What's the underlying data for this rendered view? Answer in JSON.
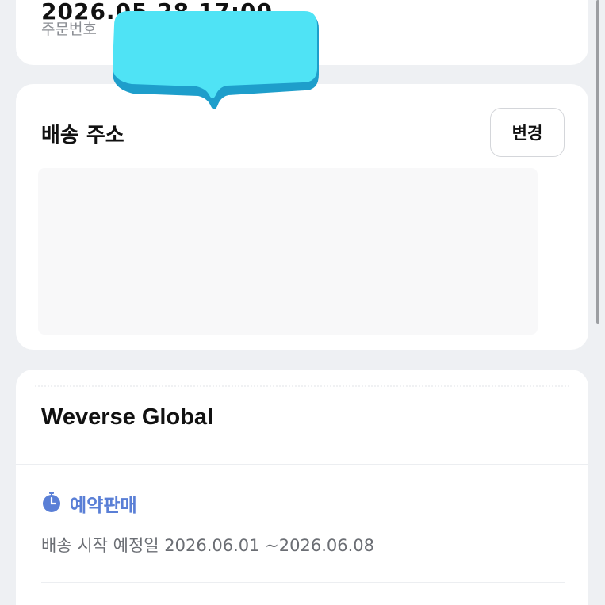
{
  "order": {
    "date": "2026.05.28 17:00",
    "number_label": "주문번호"
  },
  "address": {
    "title": "배송 주소",
    "change_label": "변경"
  },
  "shop": {
    "name": "Weverse Global",
    "preorder_label": "예약판매",
    "ship_start": "배송 시작 예정일 2026.06.01 ~2026.06.08"
  },
  "colors": {
    "background": "#eef0f3",
    "card": "#ffffff",
    "accent": "#5a7fd6",
    "sticker": "#4fe3f5"
  },
  "icons": {
    "preorder": "stopwatch-icon",
    "sticker": "speech-bubble-sticker"
  }
}
